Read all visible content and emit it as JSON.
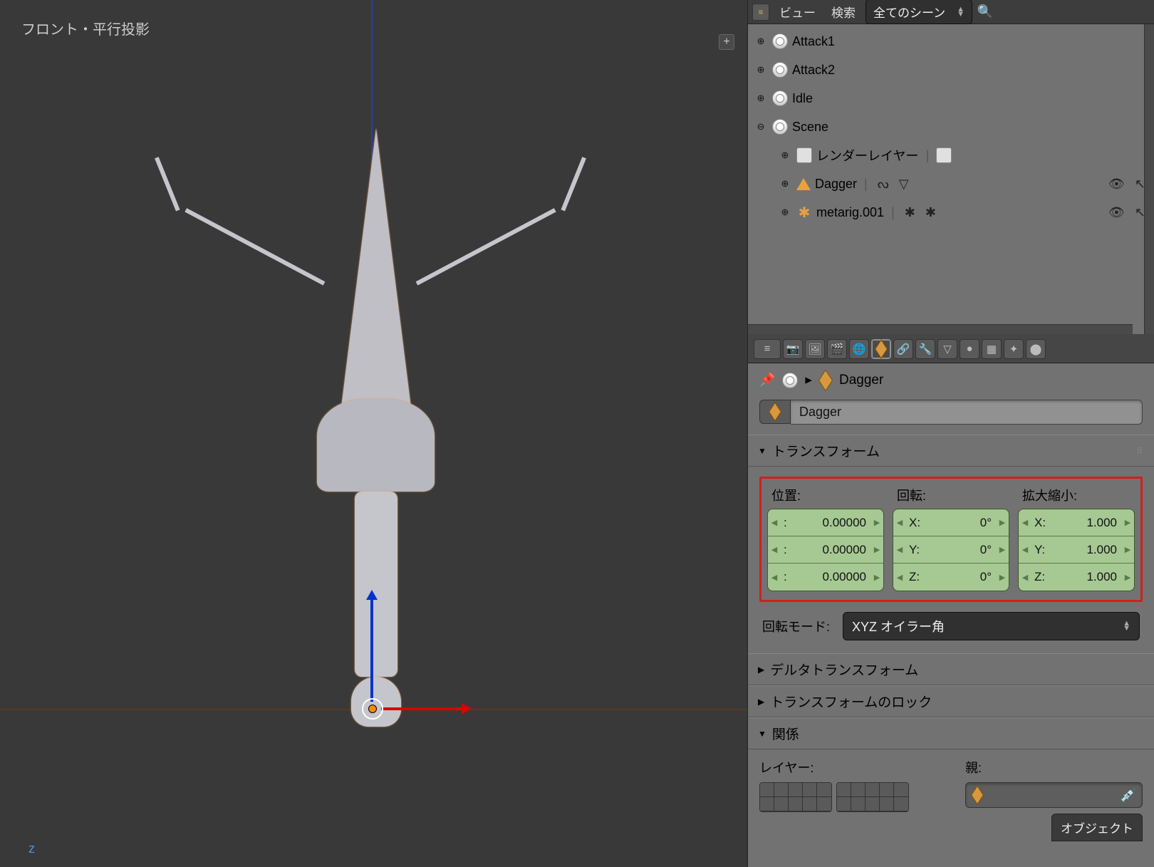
{
  "viewport": {
    "label": "フロント・平行投影",
    "axis_label": "z"
  },
  "outliner": {
    "header": {
      "view_label": "ビュー",
      "search_label": "検索",
      "filter": "全てのシーン"
    },
    "items": [
      {
        "name": "Attack1",
        "type": "scene",
        "expanded": false
      },
      {
        "name": "Attack2",
        "type": "scene",
        "expanded": false
      },
      {
        "name": "Idle",
        "type": "scene",
        "expanded": false
      },
      {
        "name": "Scene",
        "type": "scene",
        "expanded": true
      }
    ],
    "scene_children": {
      "render_layers": "レンダーレイヤー",
      "objects": [
        {
          "name": "Dagger",
          "type": "mesh"
        },
        {
          "name": "metarig.001",
          "type": "armature"
        }
      ]
    }
  },
  "properties": {
    "breadcrumb": "Dagger",
    "name_field": "Dagger",
    "panels": {
      "transform": "トランスフォーム",
      "delta": "デルタトランスフォーム",
      "lock": "トランスフォームのロック",
      "relations": "関係"
    },
    "transform": {
      "location": {
        "label": "位置:",
        "x": "0.00000",
        "y": "0.00000",
        "z": "0.00000"
      },
      "rotation": {
        "label": "回転:",
        "x_label": "X:",
        "y_label": "Y:",
        "z_label": "Z:",
        "x": "0°",
        "y": "0°",
        "z": "0°"
      },
      "scale": {
        "label": "拡大縮小:",
        "x_label": "X:",
        "y_label": "Y:",
        "z_label": "Z:",
        "x": "1.000",
        "y": "1.000",
        "z": "1.000"
      },
      "rotation_mode": {
        "label": "回転モード:",
        "value": "XYZ オイラー角"
      }
    },
    "relations": {
      "layer_label": "レイヤー:",
      "parent_label": "親:",
      "object_type": "オブジェクト"
    }
  }
}
